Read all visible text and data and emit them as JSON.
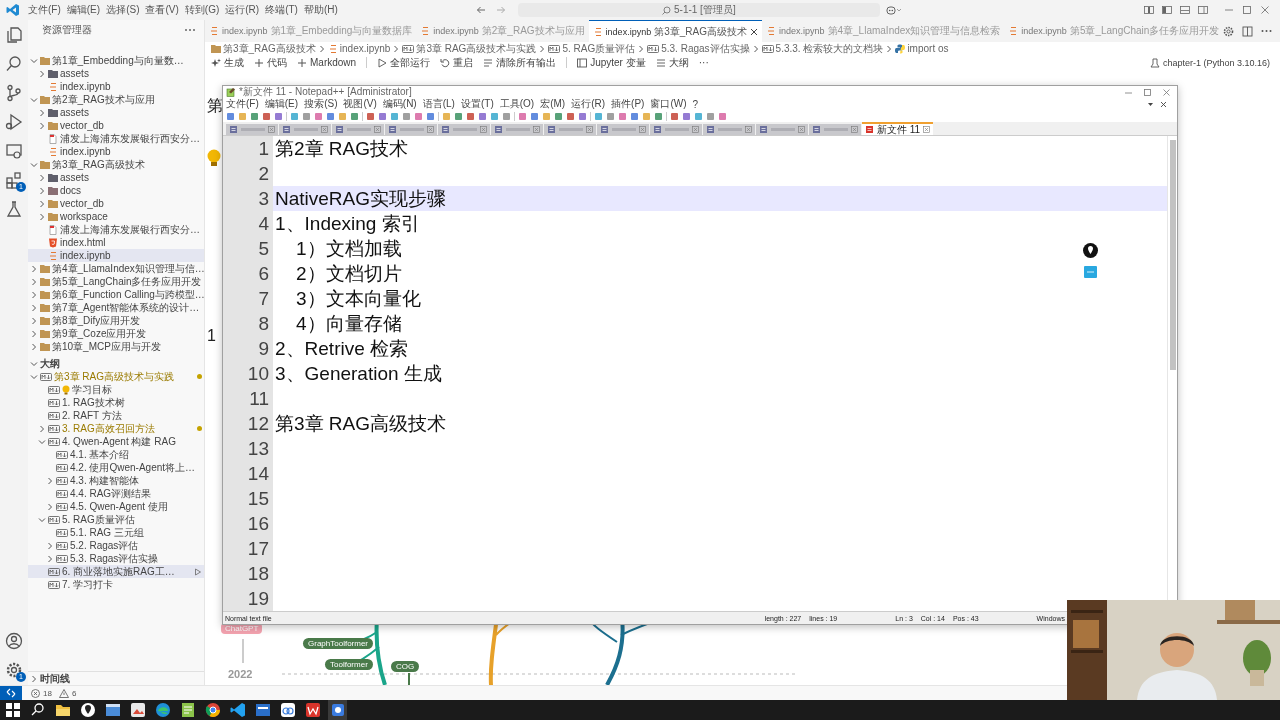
{
  "title_bar": {
    "menu": [
      "文件(F)",
      "编辑(E)",
      "选择(S)",
      "查看(V)",
      "转到(G)",
      "运行(R)",
      "终端(T)",
      "帮助(H)"
    ],
    "search": "5-1-1 [管理员]"
  },
  "activity_bar": {
    "extensions_badge": "1",
    "settings_badge": "1"
  },
  "explorer": {
    "title": "资源管理器",
    "items": [
      {
        "label": "第1章_Embedding与向量数…",
        "kind": "folder",
        "expanded": true,
        "selected": false,
        "children": [
          {
            "label": "assets",
            "kind": "asset_folder",
            "expanded": false,
            "selected": false
          },
          {
            "label": "index.ipynb",
            "kind": "notebook",
            "selected": false
          }
        ]
      },
      {
        "label": "第2章_RAG技术与应用",
        "kind": "folder",
        "expanded": true,
        "selected": false,
        "children": [
          {
            "label": "assets",
            "kind": "asset_folder",
            "expanded": false,
            "selected": false
          },
          {
            "label": "vector_db",
            "kind": "folder",
            "expanded": false,
            "selected": false
          },
          {
            "label": "浦发上海浦东发展银行西安分…",
            "kind": "pdf",
            "selected": false
          },
          {
            "label": "index.ipynb",
            "kind": "notebook",
            "selected": false
          }
        ]
      },
      {
        "label": "第3章_RAG高级技术",
        "kind": "folder",
        "expanded": true,
        "selected": false,
        "children": [
          {
            "label": "assets",
            "kind": "asset_folder",
            "expanded": false,
            "selected": false
          },
          {
            "label": "docs",
            "kind": "doc_folder",
            "expanded": false,
            "selected": false
          },
          {
            "label": "vector_db",
            "kind": "folder",
            "expanded": false,
            "selected": false
          },
          {
            "label": "workspace",
            "kind": "folder",
            "expanded": false,
            "selected": false
          },
          {
            "label": "浦发上海浦东发展银行西安分…",
            "kind": "pdf",
            "selected": false
          },
          {
            "label": "index.html",
            "kind": "html",
            "selected": false
          },
          {
            "label": "index.ipynb",
            "kind": "notebook",
            "selected": true
          }
        ]
      },
      {
        "label": "第4章_LlamaIndex知识管理与信…",
        "kind": "folder",
        "expanded": false,
        "selected": false
      },
      {
        "label": "第5章_LangChain多任务应用开发",
        "kind": "folder",
        "expanded": false,
        "selected": false
      },
      {
        "label": "第6章_Function Calling与跨模型…",
        "kind": "folder",
        "expanded": false,
        "selected": false
      },
      {
        "label": "第7章_Agent智能体系统的设计…",
        "kind": "folder",
        "expanded": false,
        "selected": false
      },
      {
        "label": "第8章_Dify应用开发",
        "kind": "folder",
        "expanded": false,
        "selected": false
      },
      {
        "label": "第9章_Coze应用开发",
        "kind": "folder",
        "expanded": false,
        "selected": false
      },
      {
        "label": "第10章_MCP应用与开发",
        "kind": "folder",
        "expanded": false,
        "selected": false
      }
    ]
  },
  "outline": {
    "title": "大纲",
    "items": [
      {
        "label": "第3章 RAG高级技术与实践",
        "kind": "markdown",
        "expanded": true,
        "modified": true,
        "selected": false,
        "children": [
          {
            "label": "学习目标",
            "kind": "goal",
            "modified": false,
            "selected": false
          },
          {
            "label": "1. RAG技术树",
            "kind": "markdown",
            "modified": false,
            "selected": false
          },
          {
            "label": "2. RAFT 方法",
            "kind": "markdown",
            "modified": false,
            "selected": false
          },
          {
            "label": "3. RAG高效召回方法",
            "kind": "markdown",
            "expanded": false,
            "modified": true,
            "selected": false
          },
          {
            "label": "4. Qwen-Agent 构建 RAG",
            "kind": "markdown",
            "expanded": true,
            "modified": false,
            "selected": false,
            "children": [
              {
                "label": "4.1. 基本介绍",
                "kind": "markdown",
                "modified": false,
                "selected": false
              },
              {
                "label": "4.2. 使用Qwen-Agent将上…",
                "kind": "markdown",
                "modified": false,
                "selected": false
              },
              {
                "label": "4.3. 构建智能体",
                "kind": "markdown",
                "expanded": false,
                "modified": false,
                "selected": false
              },
              {
                "label": "4.4. RAG评测结果",
                "kind": "markdown",
                "modified": false,
                "selected": false
              },
              {
                "label": "4.5. Qwen-Agent 使用",
                "kind": "markdown",
                "expanded": false,
                "modified": false,
                "selected": false
              }
            ]
          },
          {
            "label": "5. RAG质量评估",
            "kind": "markdown",
            "expanded": true,
            "modified": false,
            "selected": false,
            "children": [
              {
                "label": "5.1. RAG 三元组",
                "kind": "markdown",
                "modified": false,
                "selected": false
              },
              {
                "label": "5.2. Ragas评估",
                "kind": "markdown",
                "expanded": false,
                "modified": false,
                "selected": false
              },
              {
                "label": "5.3. Ragas评估实操",
                "kind": "markdown",
                "expanded": false,
                "modified": false,
                "selected": false
              }
            ]
          },
          {
            "label": "6. 商业落地实施RAG工…",
            "kind": "markdown",
            "modified": false,
            "selected": true
          },
          {
            "label": "7. 学习打卡",
            "kind": "markdown",
            "modified": false,
            "selected": false
          }
        ]
      }
    ]
  },
  "timeline": {
    "title": "时间线"
  },
  "status_bar": {
    "errors": "18",
    "warnings": "6"
  },
  "editor_tabs": [
    {
      "file": "index.ipynb",
      "folder": "第1章_Embedding与向量数据库",
      "selected": false
    },
    {
      "file": "index.ipynb",
      "folder": "第2章_RAG技术与应用",
      "selected": false
    },
    {
      "file": "index.ipynb",
      "folder": "第3章_RAG高级技术",
      "selected": true
    },
    {
      "file": "index.ipynb",
      "folder": "第4章_LlamaIndex知识管理与信息检索",
      "selected": false
    },
    {
      "file": "index.ipynb",
      "folder": "第5章_LangChain多任务应用开发",
      "selected": false
    }
  ],
  "breadcrumb": [
    {
      "kind": "folder",
      "text": "第3章_RAG高级技术"
    },
    {
      "kind": "notebook",
      "text": "index.ipynb"
    },
    {
      "kind": "markdown",
      "text": "第3章 RAG高级技术与实践"
    },
    {
      "kind": "markdown",
      "text": "5. RAG质量评估"
    },
    {
      "kind": "markdown",
      "text": "5.3. Ragas评估实操"
    },
    {
      "kind": "markdown",
      "text": "5.3.3. 检索较大的文档块"
    },
    {
      "kind": "python",
      "text": "import os"
    }
  ],
  "notebook_toolbar": {
    "buttons": [
      {
        "kind": "generate",
        "label": "生成"
      },
      {
        "kind": "add",
        "label": "代码"
      },
      {
        "kind": "add",
        "label": "Markdown"
      },
      {
        "kind": "run",
        "label": "全部运行"
      },
      {
        "kind": "restart",
        "label": "重启"
      },
      {
        "kind": "clear",
        "label": "清除所有输出"
      },
      {
        "kind": "variables",
        "label": "Jupyter 变量"
      },
      {
        "kind": "outline",
        "label": "大纲"
      },
      {
        "kind": "more",
        "label": "···"
      }
    ],
    "kernel": "chapter-1 (Python 3.10.16)"
  },
  "notebook": {
    "heading": "第",
    "number": "1",
    "mindmap": {
      "milestone": "ChatGPT",
      "year": "2022",
      "nodes": [
        "GraphToolformer",
        "Toolformer",
        "COG"
      ]
    }
  },
  "notepad": {
    "title": "*新文件 11 - Notepad++ [Administrator]",
    "menu": [
      "文件(F)",
      "编辑(E)",
      "搜索(S)",
      "视图(V)",
      "编码(N)",
      "语言(L)",
      "设置(T)",
      "工具(O)",
      "宏(M)",
      "运行(R)",
      "插件(P)",
      "窗口(W)",
      "?"
    ],
    "tabs": [
      {
        "selected": false
      },
      {
        "selected": false
      },
      {
        "selected": false
      },
      {
        "selected": false
      },
      {
        "selected": false
      },
      {
        "selected": false
      },
      {
        "selected": false
      },
      {
        "selected": false
      },
      {
        "selected": false
      },
      {
        "selected": false
      },
      {
        "selected": false
      },
      {
        "selected": false
      },
      {
        "label": "新文件 11",
        "selected": true
      }
    ],
    "lines": [
      {
        "number": "1",
        "text": "第2章 RAG技术",
        "current": false
      },
      {
        "number": "2",
        "current": false
      },
      {
        "number": "3",
        "text": "NativeRAG实现步骤",
        "current": true
      },
      {
        "number": "4",
        "text": "1、Indexing 索引",
        "current": false
      },
      {
        "number": "5",
        "text": "    1）文档加载",
        "current": false
      },
      {
        "number": "6",
        "text": "    2）文档切片",
        "current": false
      },
      {
        "number": "7",
        "text": "    3）文本向量化",
        "current": false
      },
      {
        "number": "8",
        "text": "    4）向量存储",
        "current": false
      },
      {
        "number": "9",
        "text": "2、Retrive 检索",
        "current": false
      },
      {
        "number": "10",
        "text": "3、Generation 生成",
        "current": false
      },
      {
        "number": "11",
        "current": false
      },
      {
        "number": "12",
        "text": "第3章 RAG高级技术",
        "current": false
      },
      {
        "number": "13",
        "current": false
      },
      {
        "number": "14",
        "current": false
      },
      {
        "number": "15",
        "current": false
      },
      {
        "number": "16",
        "current": false
      },
      {
        "number": "17",
        "current": false
      },
      {
        "number": "18",
        "current": false
      },
      {
        "number": "19",
        "current": false
      }
    ],
    "status": {
      "type": "Normal text file",
      "length": "length : 227",
      "lines": "lines : 19",
      "ln": "Ln : 3",
      "col": "Col : 14",
      "pos": "Pos : 43",
      "eol": "Windows"
    }
  }
}
